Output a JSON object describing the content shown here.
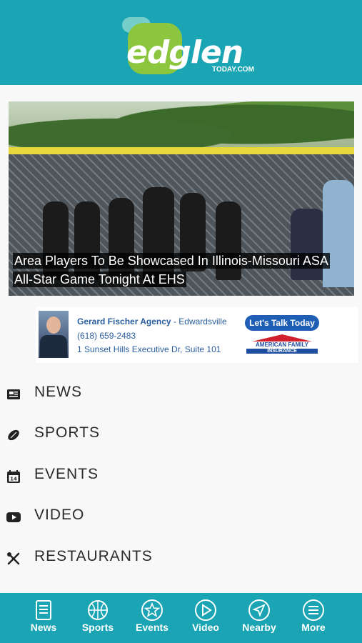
{
  "header": {
    "logo_word": "edglen",
    "logo_sub": "TODAY.COM",
    "background_color": "#1aa4b4",
    "logo_accent_color": "#8cc63f"
  },
  "hero": {
    "headline_line1": "Area Players To Be Showcased In Illinois-Missouri ASA",
    "headline_line2": "All-Star Game Tonight At EHS"
  },
  "ad": {
    "agency": "Gerard Fischer Agency",
    "separator": " - ",
    "location": "Edwardsville",
    "phone": "(618) 659-2483",
    "address": "1 Sunset Hills Executive Dr, Suite 101",
    "cta": "Let's Talk Today",
    "brand_line1": "AMERICAN FAMILY",
    "brand_line2": "INSURANCE"
  },
  "menu": {
    "items": [
      {
        "label": "NEWS",
        "icon": "newspaper-icon"
      },
      {
        "label": "SPORTS",
        "icon": "football-icon"
      },
      {
        "label": "EVENTS",
        "icon": "calendar-icon"
      },
      {
        "label": "VIDEO",
        "icon": "play-button-icon"
      },
      {
        "label": "RESTAURANTS",
        "icon": "fork-knife-icon"
      }
    ]
  },
  "tabbar": {
    "tabs": [
      {
        "label": "News",
        "icon": "news-list-icon"
      },
      {
        "label": "Sports",
        "icon": "basketball-icon"
      },
      {
        "label": "Events",
        "icon": "star-icon"
      },
      {
        "label": "Video",
        "icon": "play-circle-icon"
      },
      {
        "label": "Nearby",
        "icon": "navigation-arrow-icon"
      },
      {
        "label": "More",
        "icon": "menu-lines-icon"
      }
    ]
  }
}
